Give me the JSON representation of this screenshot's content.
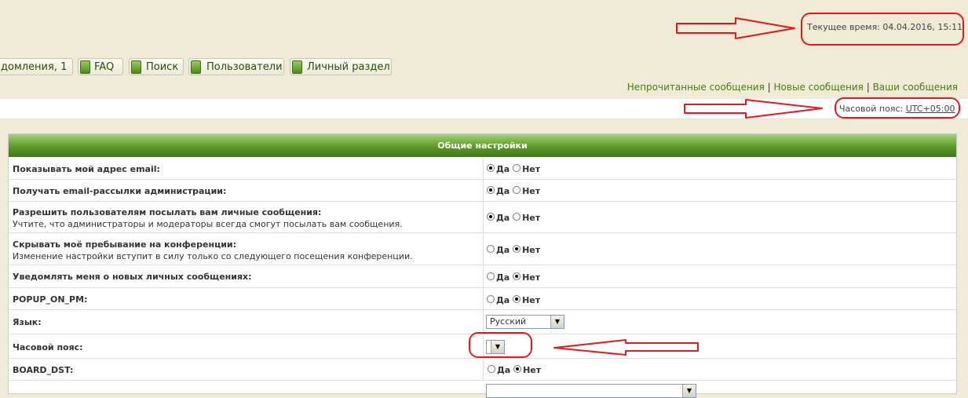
{
  "header": {
    "current_time_label": "Текущее время: 04.04.2016, 15:11",
    "timezone_label": "Часовой пояс:",
    "timezone_value": "UTC+05:00"
  },
  "nav": {
    "items": [
      {
        "label": "домления, 1"
      },
      {
        "label": "FAQ"
      },
      {
        "label": "Поиск"
      },
      {
        "label": "Пользователи"
      },
      {
        "label": "Личный раздел"
      }
    ]
  },
  "links": {
    "unread": "Непрочитанные сообщения",
    "new": "Новые сообщения",
    "yours": "Ваши сообщения",
    "sep": "|"
  },
  "panel": {
    "title": "Общие настройки",
    "yes": "Да",
    "no": "Нет",
    "rows": [
      {
        "label": "Показывать мой адрес email:",
        "selected": "yes"
      },
      {
        "label": "Получать email-рассылки администрации:",
        "selected": "yes"
      },
      {
        "label": "Разрешить пользователям посылать вам личные сообщения:",
        "sub": "Учтите, что администраторы и модераторы всегда смогут посылать вам сообщения.",
        "selected": "yes"
      },
      {
        "label": "Скрывать моё пребывание на конференции:",
        "sub": "Изменение настройки вступит в силу только со следующего посещения конференции.",
        "selected": "no"
      },
      {
        "label": "Уведомлять меня о новых личных сообщениях:",
        "selected": "no"
      },
      {
        "label": "POPUP_ON_PM:",
        "selected": "no"
      },
      {
        "label": "Язык:",
        "select_value": "Русский"
      },
      {
        "label": "Часовой пояс:",
        "select_value": ""
      },
      {
        "label": "BOARD_DST:",
        "selected": "no"
      }
    ]
  },
  "annotation_color": "#e01b1b"
}
